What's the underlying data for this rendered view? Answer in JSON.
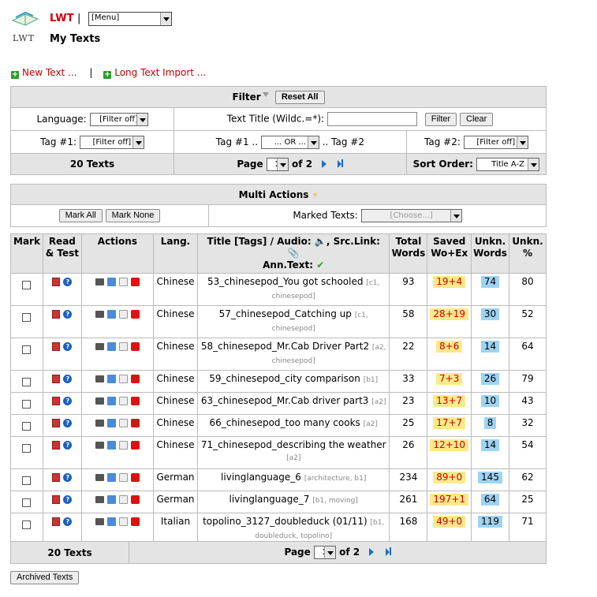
{
  "header": {
    "brand": "LWT",
    "separator": "|",
    "menu_value": "[Menu]",
    "page_title": "My Texts",
    "logo_text": "LWT"
  },
  "links": {
    "new_text": "New Text ...",
    "sep": "|",
    "long_import": "Long Text Import ..."
  },
  "filter": {
    "title": "Filter",
    "reset_all": "Reset All",
    "language_label": "Language:",
    "language_value": "[Filter off]",
    "title_label": "Text Title (Wildc.=*):",
    "filter_btn": "Filter",
    "clear_btn": "Clear",
    "tag1_label": "Tag #1:",
    "tag1_value": "[Filter off]",
    "tagop_label_pre": "Tag #1 ..",
    "tagop_value": "... OR ...",
    "tagop_label_post": ".. Tag #2",
    "tag2_label": "Tag #2:",
    "tag2_value": "[Filter off]",
    "count": "20 Texts",
    "page_label": "Page",
    "page_value": "1",
    "of_label": "of 2",
    "sort_label": "Sort Order:",
    "sort_value": "Title A-Z"
  },
  "multi": {
    "title": "Multi Actions",
    "mark_all": "Mark All",
    "mark_none": "Mark None",
    "marked_label": "Marked Texts:",
    "marked_value": "[Choose...]"
  },
  "table": {
    "headers": {
      "mark": "Mark",
      "read": "Read & Test",
      "actions": "Actions",
      "lang": "Lang.",
      "title": "Title [Tags] / Audio:",
      "srclink": ", Src.Link:",
      "anntext": "Ann.Text:",
      "total": "Total Words",
      "saved": "Saved Wo+Ex",
      "unkn": "Unkn. Words",
      "unknpct": "Unkn. %"
    },
    "rows": [
      {
        "lang": "Chinese",
        "title": "53_chinesepod_You got schooled",
        "tags": "[c1, chinesepod]",
        "total": "93",
        "saved": "19+4",
        "unkn": "74",
        "pct": "80"
      },
      {
        "lang": "Chinese",
        "title": "57_chinesepod_Catching up",
        "tags": "[c1, chinesepod]",
        "total": "58",
        "saved": "28+19",
        "unkn": "30",
        "pct": "52"
      },
      {
        "lang": "Chinese",
        "title": "58_chinesepod_Mr.Cab Driver Part2",
        "tags": "[a2, chinesepod]",
        "total": "22",
        "saved": "8+6",
        "unkn": "14",
        "pct": "64"
      },
      {
        "lang": "Chinese",
        "title": "59_chinesepod_city comparison",
        "tags": "[b1]",
        "total": "33",
        "saved": "7+3",
        "unkn": "26",
        "pct": "79"
      },
      {
        "lang": "Chinese",
        "title": "63_chinesepod_Mr.Cab driver part3",
        "tags": "[a2]",
        "total": "23",
        "saved": "13+7",
        "unkn": "10",
        "pct": "43"
      },
      {
        "lang": "Chinese",
        "title": "66_chinesepod_too many cooks",
        "tags": "[a2]",
        "total": "25",
        "saved": "17+7",
        "unkn": "8",
        "pct": "32"
      },
      {
        "lang": "Chinese",
        "title": "71_chinesepod_describing the weather",
        "tags": "[a2]",
        "total": "26",
        "saved": "12+10",
        "unkn": "14",
        "pct": "54"
      },
      {
        "lang": "German",
        "title": "livinglanguage_6",
        "tags": "[architecture, b1]",
        "total": "234",
        "saved": "89+0",
        "unkn": "145",
        "pct": "62"
      },
      {
        "lang": "German",
        "title": "livinglanguage_7",
        "tags": "[b1, moving]",
        "total": "261",
        "saved": "197+1",
        "unkn": "64",
        "pct": "25"
      },
      {
        "lang": "Italian",
        "title": "topolino_3127_doubleduck (01/11)",
        "tags": "[b1, doubleduck, topolino]",
        "total": "168",
        "saved": "49+0",
        "unkn": "119",
        "pct": "71"
      }
    ]
  },
  "footer": {
    "count": "20 Texts",
    "page_label": "Page",
    "page_value": "1",
    "of_label": "of 2",
    "archived": "Archived Texts"
  },
  "colors": {
    "brand": "#cc0000",
    "saved_bg": "#ffe98a",
    "unkn_bg": "#9fd3f3",
    "header_bg": "#e4e4e4"
  }
}
